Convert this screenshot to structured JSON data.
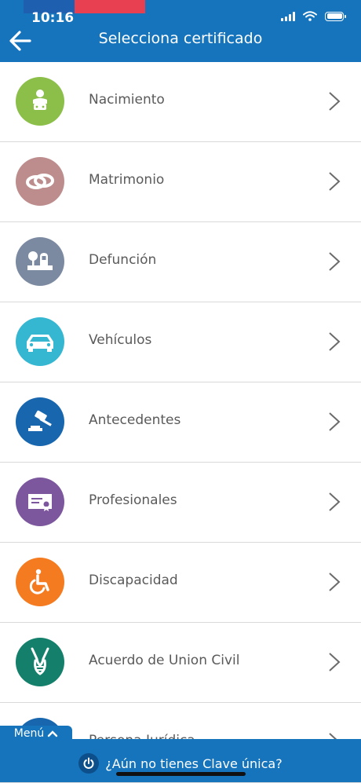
{
  "status": {
    "time": "10:16"
  },
  "header": {
    "title": "Selecciona certificado",
    "back_icon": "arrow-left-icon"
  },
  "items": [
    {
      "label": "Nacimiento",
      "icon": "baby-icon",
      "color": "#8cbf4a"
    },
    {
      "label": "Matrimonio",
      "icon": "rings-icon",
      "color": "#bd8d8d"
    },
    {
      "label": "Defunción",
      "icon": "tombstone-icon",
      "color": "#7b8aa1"
    },
    {
      "label": "Vehículos",
      "icon": "car-icon",
      "color": "#35b6d1"
    },
    {
      "label": "Antecedentes",
      "icon": "gavel-icon",
      "color": "#1766ae"
    },
    {
      "label": "Profesionales",
      "icon": "diploma-icon",
      "color": "#7c579d"
    },
    {
      "label": "Discapacidad",
      "icon": "wheelchair-icon",
      "color": "#f47b20"
    },
    {
      "label": "Acuerdo de Union Civil",
      "icon": "hands-icon",
      "color": "#14806b"
    },
    {
      "label": "Persona Jurídica",
      "icon": "building-icon",
      "color": "#1766ae"
    }
  ],
  "footer": {
    "menu_label": "Menú",
    "clave_label": "¿Aún no tienes Clave única?"
  },
  "colors": {
    "primary": "#1574bc",
    "flag_red": "#e84050",
    "flag_blue": "#1f5fb0"
  }
}
